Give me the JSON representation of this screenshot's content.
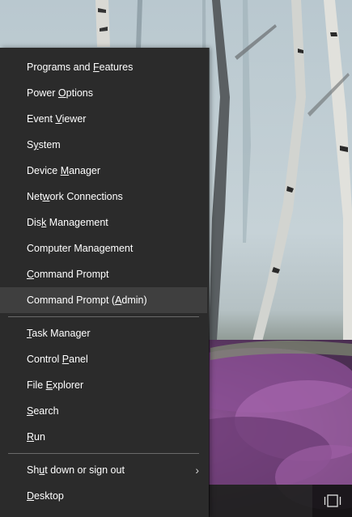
{
  "menu": {
    "items": [
      {
        "label_pre": "Programs and ",
        "mnemonic": "F",
        "label_post": "eatures"
      },
      {
        "label_pre": "Power ",
        "mnemonic": "O",
        "label_post": "ptions"
      },
      {
        "label_pre": "Event ",
        "mnemonic": "V",
        "label_post": "iewer"
      },
      {
        "label_pre": "S",
        "mnemonic": "y",
        "label_post": "stem"
      },
      {
        "label_pre": "Device ",
        "mnemonic": "M",
        "label_post": "anager"
      },
      {
        "label_pre": "Net",
        "mnemonic": "w",
        "label_post": "ork Connections"
      },
      {
        "label_pre": "Dis",
        "mnemonic": "k",
        "label_post": " Management"
      },
      {
        "label_pre": "Computer Mana",
        "mnemonic": "g",
        "label_post": "ement"
      },
      {
        "label_pre": "",
        "mnemonic": "C",
        "label_post": "ommand Prompt"
      },
      {
        "label_pre": "Command Prompt (",
        "mnemonic": "A",
        "label_post": "dmin)"
      },
      {
        "label_pre": "",
        "mnemonic": "T",
        "label_post": "ask Manager"
      },
      {
        "label_pre": "Control ",
        "mnemonic": "P",
        "label_post": "anel"
      },
      {
        "label_pre": "File ",
        "mnemonic": "E",
        "label_post": "xplorer"
      },
      {
        "label_pre": "",
        "mnemonic": "S",
        "label_post": "earch"
      },
      {
        "label_pre": "",
        "mnemonic": "R",
        "label_post": "un"
      },
      {
        "label_pre": "Sh",
        "mnemonic": "u",
        "label_post": "t down or sign out"
      },
      {
        "label_pre": "",
        "mnemonic": "D",
        "label_post": "esktop"
      }
    ],
    "highlighted_index": 9,
    "submenu_chevron": "›"
  },
  "taskbar": {
    "mic_icon": "microphone-icon",
    "task_view_icon": "task-view-icon"
  },
  "colors": {
    "menu_bg": "#2b2b2b",
    "highlight_bg": "#3f3f3f",
    "separator": "#6a6a6a",
    "text": "#ffffff"
  }
}
